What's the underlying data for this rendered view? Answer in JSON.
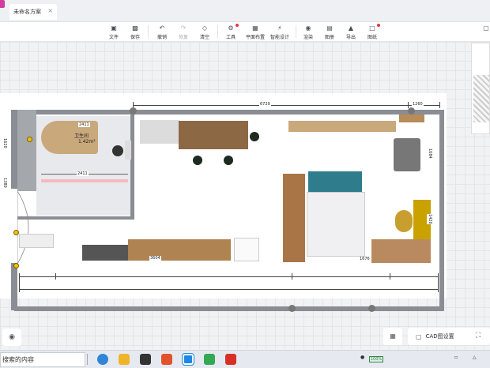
{
  "tab": {
    "title": "未命名方案",
    "close": "×"
  },
  "toolbar": {
    "items": [
      {
        "label": "文件",
        "icon": "file-icon"
      },
      {
        "label": "保存",
        "icon": "save-icon"
      },
      {
        "label": "撤销",
        "icon": "undo-icon"
      },
      {
        "label": "恢复",
        "icon": "redo-icon"
      },
      {
        "label": "清空",
        "icon": "eraser-icon"
      },
      {
        "label": "工具",
        "icon": "wrench-icon"
      },
      {
        "label": "平面布置",
        "icon": "layout-icon"
      },
      {
        "label": "智能设计",
        "icon": "lightning-icon"
      },
      {
        "label": "渲染",
        "icon": "camera-icon"
      },
      {
        "label": "图册",
        "icon": "album-icon"
      },
      {
        "label": "导出",
        "icon": "export-icon"
      },
      {
        "label": "图纸",
        "icon": "drawing-icon"
      }
    ]
  },
  "plan": {
    "dims": {
      "top_main": "6729",
      "top_right": "1260",
      "bath_top": "2411",
      "bath_bottom": "2411",
      "left_upper": "1620",
      "left_mid": "1380",
      "right_upper": "1684",
      "right_lower": "1420",
      "bottom_a": "3604",
      "bottom_b": "1676"
    },
    "room": {
      "name": "卫生间",
      "area": "1.42m²"
    }
  },
  "controls": {
    "cad_label": "CAD图设置"
  },
  "taskbar": {
    "search_text": "搜索的内容",
    "battery": "100%"
  }
}
